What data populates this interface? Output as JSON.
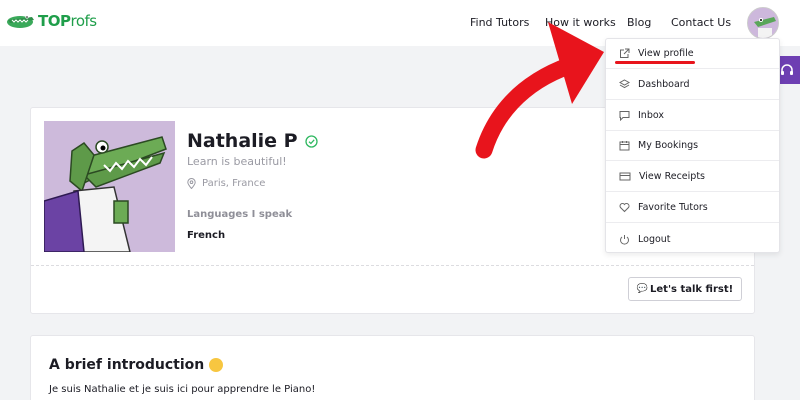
{
  "header": {
    "logo": {
      "top": "TOP",
      "rofs": "rofs"
    },
    "nav": [
      "Find Tutors",
      "How it works",
      "Blog",
      "Contact Us"
    ]
  },
  "profile": {
    "name": "Nathalie P",
    "tagline": "Learn is beautiful!",
    "location": "Paris, France",
    "languages_label": "Languages I speak",
    "language": "French",
    "talk_button": "Let's talk first!",
    "talk_button_icon": "💬"
  },
  "intro": {
    "title": "A brief introduction",
    "text": "Je suis Nathalie et je suis ici pour apprendre le Piano!"
  },
  "menu": {
    "items": [
      {
        "label": "View profile",
        "icon": "external-link-icon"
      },
      {
        "label": "Dashboard",
        "icon": "layers-icon"
      },
      {
        "label": "Inbox",
        "icon": "message-icon"
      },
      {
        "label": "My Bookings",
        "icon": "calendar-icon"
      },
      {
        "label": "View Receipts",
        "icon": "card-icon"
      },
      {
        "label": "Favorite Tutors",
        "icon": "heart-icon"
      },
      {
        "label": "Logout",
        "icon": "power-icon"
      }
    ]
  },
  "colors": {
    "brand_green": "#1f9e4a",
    "support_purple": "#6d3fb2",
    "annotation_red": "#e8141c",
    "verified_green": "#2fb860"
  }
}
